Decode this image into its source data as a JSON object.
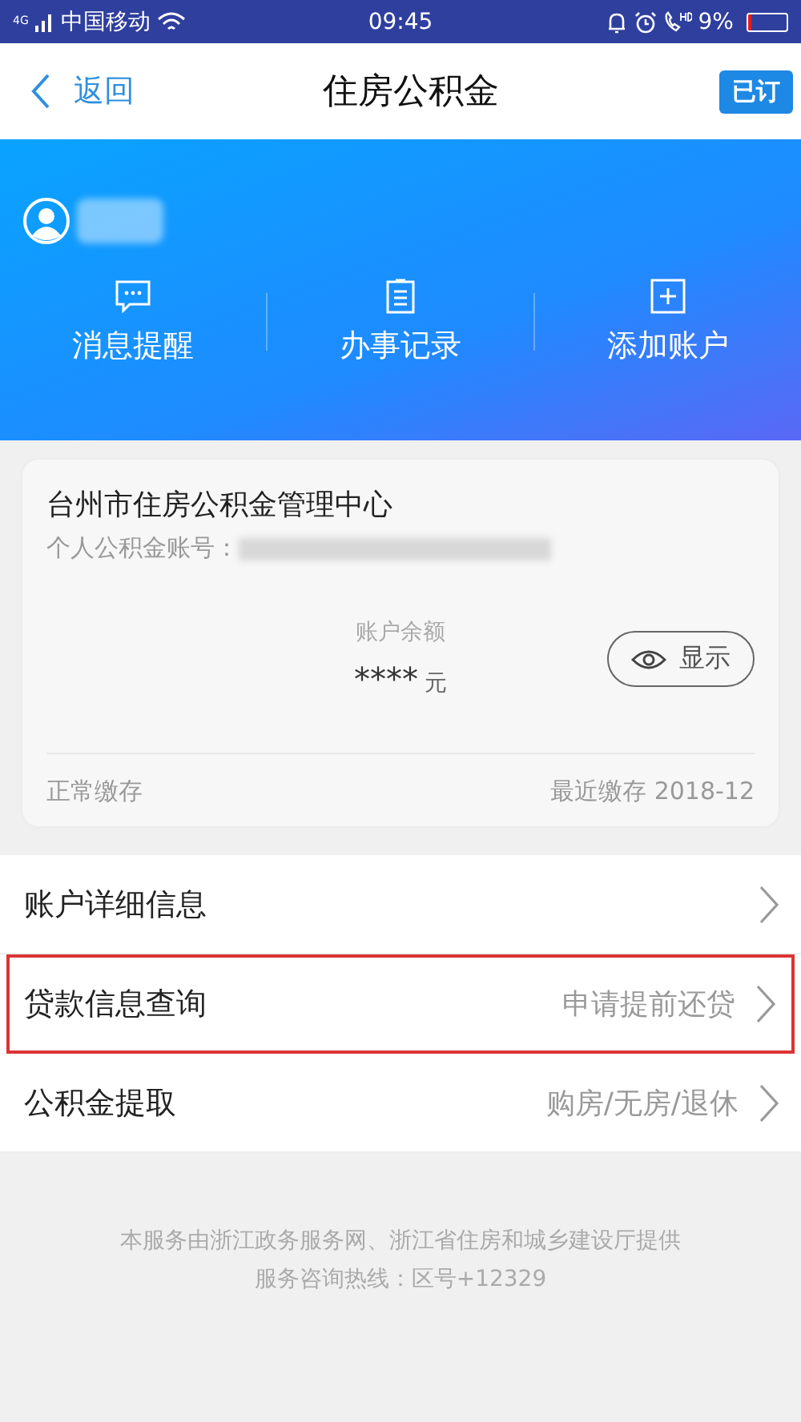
{
  "status_bar": {
    "network": "4G",
    "carrier": "中国移动",
    "time": "09:45",
    "battery": "9%"
  },
  "nav": {
    "back": "返回",
    "title": "住房公积金",
    "badge": "已订"
  },
  "header": {
    "actions": [
      {
        "kind": "message",
        "label": "消息提醒"
      },
      {
        "kind": "record",
        "label": "办事记录"
      },
      {
        "kind": "add",
        "label": "添加账户"
      }
    ]
  },
  "account_card": {
    "center": "台州市住房公积金管理中心",
    "account_label": "个人公积金账号：",
    "balance_label": "账户余额",
    "balance": "****",
    "unit": "元",
    "show_button": "显示",
    "status": "正常缴存",
    "last_payment": "最近缴存 2018-12"
  },
  "menu": [
    {
      "label": "账户详细信息",
      "highlighted": false
    },
    {
      "label": "贷款信息查询",
      "detail": "申请提前还贷",
      "highlighted": true
    },
    {
      "label": "公积金提取",
      "detail": "购房/无房/退休",
      "highlighted": false
    }
  ],
  "footer": [
    "本服务由浙江政务服务网、浙江省住房和城乡建设厅提供",
    "服务咨询热线：区号+12329"
  ]
}
